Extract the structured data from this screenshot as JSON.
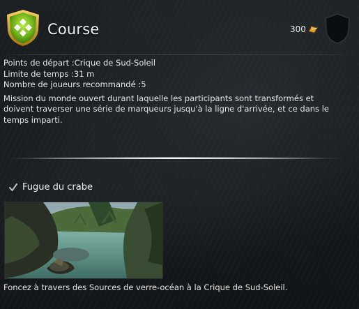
{
  "event": {
    "title": "Course",
    "reward_value": "300",
    "reward_icon": "karma-icon",
    "badge_icon": "race-event-badge-icon"
  },
  "details": {
    "start": "Points de départ :Crique de Sud-Soleil",
    "time_limit": "Limite de temps :31 m",
    "players": "Nombre de joueurs recommandé :5",
    "description": "Mission du monde ouvert durant laquelle les participants sont transformés et doivent traverser une série de marqueurs jusqu'à la ligne d'arrivée, et ce dans le temps imparti."
  },
  "objective": {
    "name": "Fugue du crabe",
    "status_icon": "checkmark-icon"
  },
  "preview": {
    "caption": "Foncez à travers des Sources de verre-océan à la Crique de Sud-Soleil."
  },
  "colors": {
    "badge_green": "#7cc21c",
    "badge_gold": "#d9a520",
    "text": "#e6e6e6"
  }
}
